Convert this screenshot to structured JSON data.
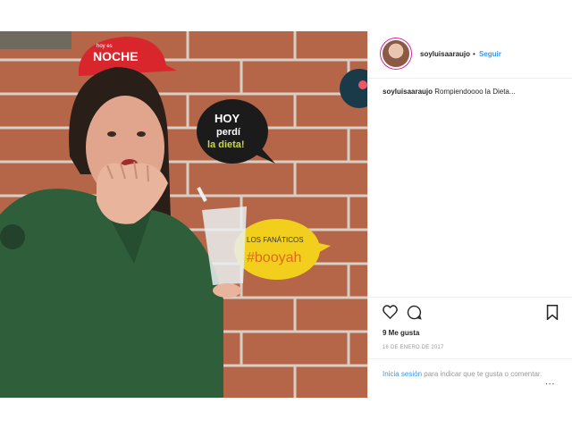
{
  "post": {
    "username": "soyluisaaraujo",
    "follow_label": "Seguir",
    "separator": "•",
    "caption": "Rompiendoooo la Dieta...",
    "likes": "9 Me gusta",
    "date": "16 DE ENERO DE 2017",
    "login_link": "Inicia sesión",
    "login_rest": "para indicar que te gusta o comentar.",
    "more_label": "..."
  },
  "photo_signs": {
    "sign1_small": "hoy es",
    "sign1_big": "NOCHE",
    "sign2_line1": "HOY",
    "sign2_line2": "perdí",
    "sign2_line3": "la dieta!",
    "sign3_line1": "LOS FANÁTICOS",
    "sign3_line2": "#booyah"
  },
  "colors": {
    "link": "#3897f0",
    "brick": "#a0553f",
    "uniform": "#2f5e3b"
  }
}
